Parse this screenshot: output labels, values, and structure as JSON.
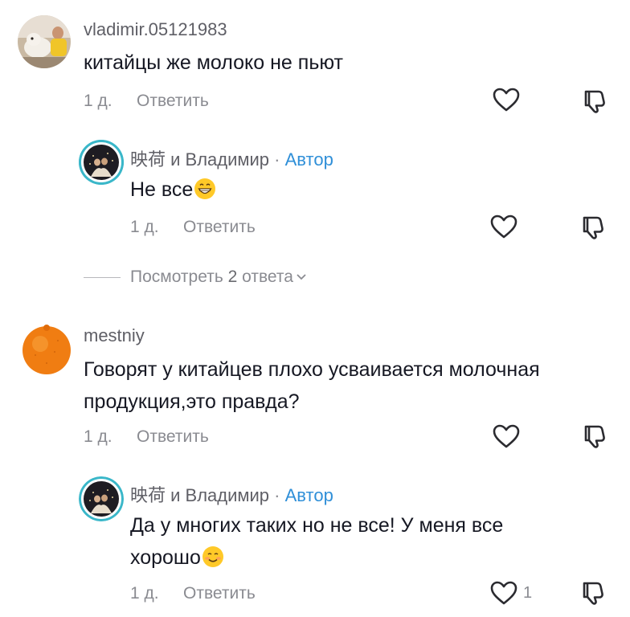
{
  "comments": [
    {
      "username": "vladimir.05121983",
      "text": "китайцы же молоко не пьют",
      "time": "1 д.",
      "reply_label": "Ответить"
    },
    {
      "username": "映荷 и Владимир",
      "separator": "·",
      "badge": "Автор",
      "text": "Не все",
      "emoji": "grinning-face",
      "time": "1 д.",
      "reply_label": "Ответить"
    },
    {
      "username": "mestniy",
      "text_line1": "Говорят у китайцев плохо усваивается молочная",
      "text_line2": "продукция,это правда?",
      "time": "1 д.",
      "reply_label": "Ответить"
    },
    {
      "username": "映荷 и Владимир",
      "separator": "·",
      "badge": "Автор",
      "text_line1": "Да у многих таких но не все! У меня все",
      "text_line2": "хорошо",
      "emoji": "smiling-face",
      "time": "1 д.",
      "reply_label": "Ответить",
      "likes": "1"
    }
  ],
  "view_replies": {
    "prefix": "Посмотреть",
    "count": "2",
    "suffix": "ответа"
  },
  "icons": {
    "like": "heart-outline-icon",
    "dislike": "thumbs-down-outline-icon",
    "expand": "chevron-down-icon"
  },
  "colors": {
    "author_badge": "#2f8fd8",
    "author_ring": "#3ab7c9",
    "secondary_text": "#8a8b91"
  }
}
